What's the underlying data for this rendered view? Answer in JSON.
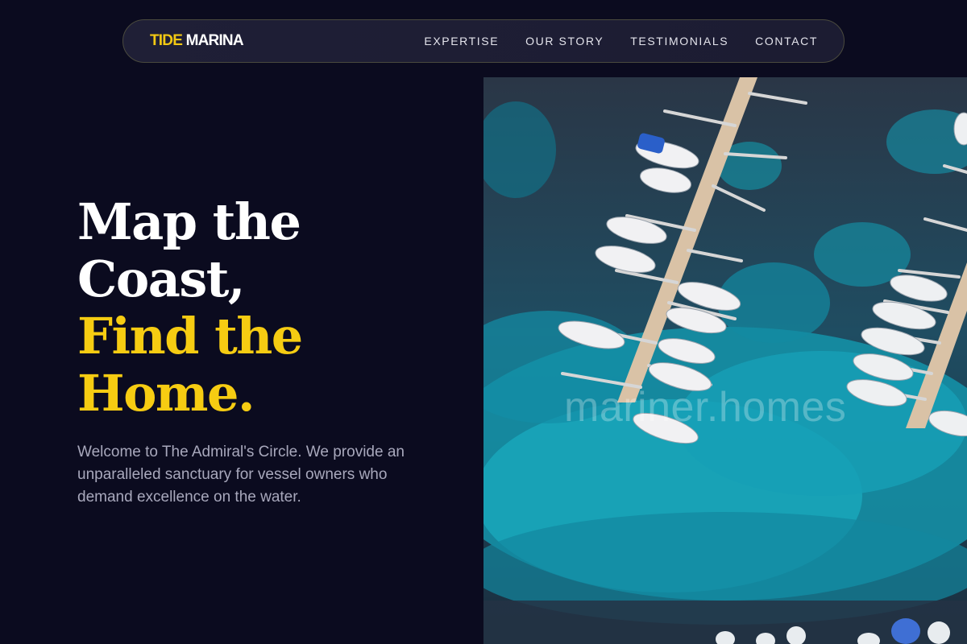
{
  "nav": {
    "brand_part1": "TIDE",
    "brand_part2": "MARINA",
    "links": [
      "EXPERTISE",
      "OUR STORY",
      "TESTIMONIALS",
      "CONTACT"
    ]
  },
  "hero": {
    "headline_line1": "Map the",
    "headline_line2": "Coast,",
    "headline_line3": "Find the",
    "headline_line4": "Home.",
    "lead": "Welcome to The Admiral's Circle. We provide an unparalleled sanctuary for vessel owners who demand excellence on the water.",
    "image_watermark": "mariner.homes"
  },
  "colors": {
    "background": "#0b0b1f",
    "accent": "#f6cc12",
    "text_muted": "#a8a8bc"
  }
}
